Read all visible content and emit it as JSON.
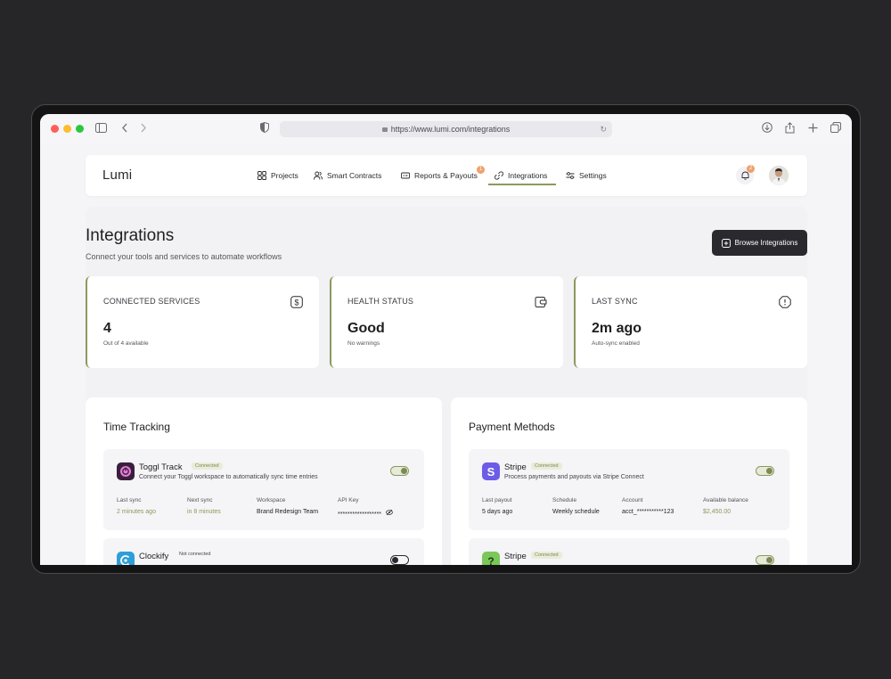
{
  "browser": {
    "url": "https://www.lumi.com/integrations"
  },
  "app": {
    "logo": "Lumi",
    "nav": [
      {
        "label": "Projects",
        "icon": "grid-icon"
      },
      {
        "label": "Smart Contracts",
        "icon": "users-icon"
      },
      {
        "label": "Reports & Payouts",
        "icon": "report-icon",
        "badge": "1"
      },
      {
        "label": "Integrations",
        "icon": "link-icon",
        "active": true
      },
      {
        "label": "Settings",
        "icon": "sliders-icon"
      }
    ],
    "notification_badge": "2"
  },
  "page": {
    "title": "Integrations",
    "subtitle": "Connect your tools and services to automate workflows",
    "browse_button": "Browse Integrations"
  },
  "stats": [
    {
      "label": "CONNECTED SERVICES",
      "value": "4",
      "sub": "Out of 4 available",
      "icon": "dollar-icon"
    },
    {
      "label": "HEALTH STATUS",
      "value": "Good",
      "sub": "No warnings",
      "icon": "wallet-icon"
    },
    {
      "label": "LAST SYNC",
      "value": "2m ago",
      "sub": "Auto-sync enabled",
      "icon": "alert-octagon-icon"
    }
  ],
  "time_tracking": {
    "title": "Time Tracking",
    "cards": [
      {
        "name": "Toggl Track",
        "status": "Connected",
        "description": "Connect your Toggl workspace to automatically sync time entries",
        "enabled": true,
        "meta": [
          {
            "key": "Last sync",
            "value": "2 minutes ago"
          },
          {
            "key": "Next sync",
            "value": "in 8 minutes"
          },
          {
            "key": "Workspace",
            "value": "Brand Redesign Team"
          },
          {
            "key": "API Key",
            "value": "******************"
          }
        ]
      },
      {
        "name": "Clockify",
        "status": "Not connected",
        "enabled": false
      }
    ]
  },
  "payment_methods": {
    "title": "Payment Methods",
    "cards": [
      {
        "name": "Stripe",
        "status": "Connected",
        "description": "Process payments and payouts via Stripe Connect",
        "enabled": true,
        "meta": [
          {
            "key": "Last payout",
            "value": "5 days ago"
          },
          {
            "key": "Schedule",
            "value": "Weekly schedule"
          },
          {
            "key": "Account",
            "value": "acct_***********123"
          },
          {
            "key": "Available balance",
            "value": "$2,450.00"
          }
        ]
      },
      {
        "name": "Stripe",
        "status": "Connected",
        "enabled": true
      }
    ]
  },
  "colors": {
    "accent": "#8a9a5b",
    "dark": "#2a2a2e",
    "badge": "#f0a06b"
  }
}
